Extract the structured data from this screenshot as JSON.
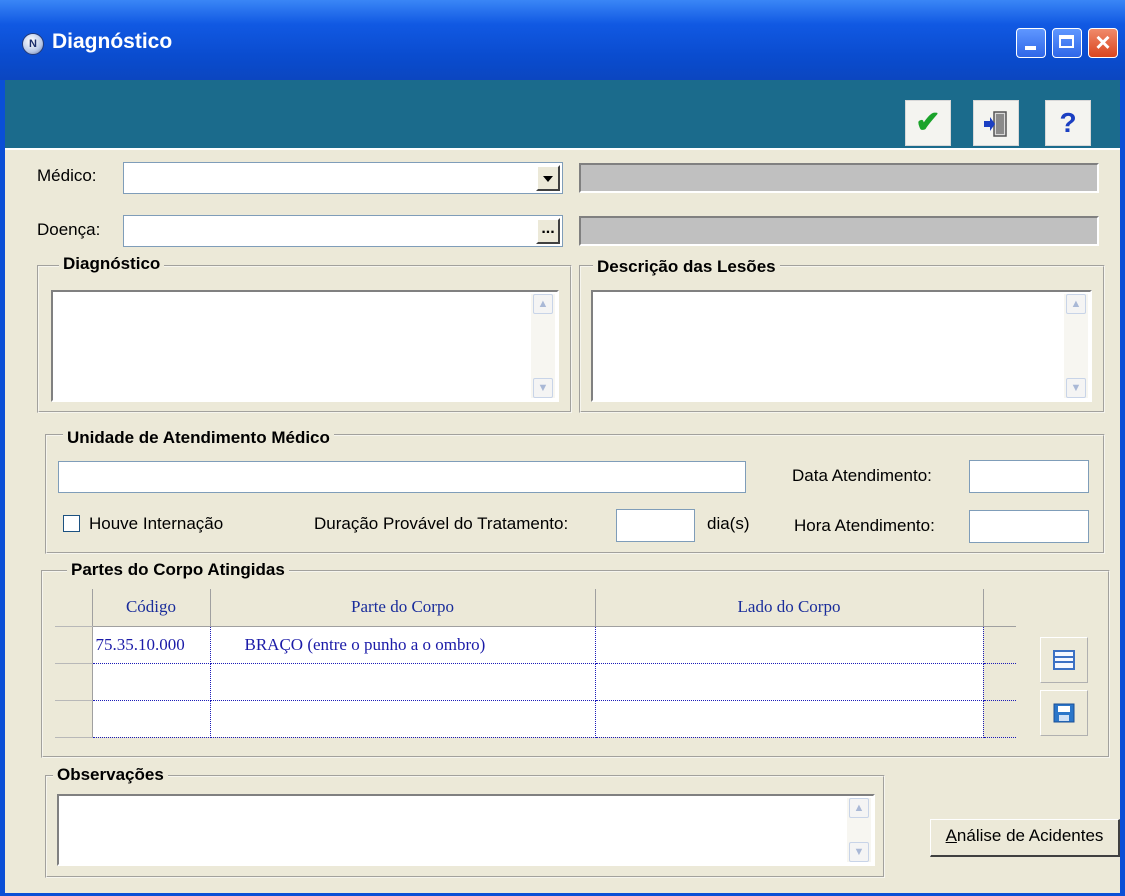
{
  "window": {
    "title": "Diagnóstico",
    "app_icon": "N"
  },
  "toolbar": {
    "ok_icon": "✔",
    "exit_icon": "exit-door-icon",
    "help_icon": "?"
  },
  "form": {
    "medico_label": "Médico:",
    "medico_value": "",
    "medico_desc": "",
    "doenca_label": "Doença:",
    "doenca_value": "",
    "doenca_button": "...",
    "doenca_desc": ""
  },
  "groups": {
    "diagnostico": "Diagnóstico",
    "descricao_lesoes": "Descrição das Lesões",
    "unidade": "Unidade de Atendimento Médico",
    "partes": "Partes do Corpo Atingidas",
    "observacoes": "Observações"
  },
  "unidade": {
    "unidade_value": "",
    "data_label": "Data Atendimento:",
    "data_value": "",
    "hora_label": "Hora Atendimento:",
    "hora_value": "",
    "internacao_label": "Houve Internação",
    "internacao_checked": false,
    "duracao_label": "Duração Provável do Tratamento:",
    "duracao_value": "",
    "dias_label": "dia(s)"
  },
  "grid": {
    "columns": [
      "Código",
      "Parte do Corpo",
      "Lado do Corpo"
    ],
    "rows": [
      [
        "75.35.10.000",
        "BRAÇO (entre o punho a o ombro)",
        ""
      ],
      [
        "",
        "",
        ""
      ],
      [
        "",
        "",
        ""
      ]
    ]
  },
  "side_buttons": {
    "list_icon": "list-icon",
    "save_icon": "save-icon"
  },
  "actions": {
    "analise_label": "Análise de Acidentes",
    "analise_accesskey": "A"
  },
  "colors": {
    "titlebar": "#0a4ccf",
    "toolbar": "#1b6b8c",
    "client": "#ece9d8",
    "grid_text": "#1b1ba8"
  }
}
